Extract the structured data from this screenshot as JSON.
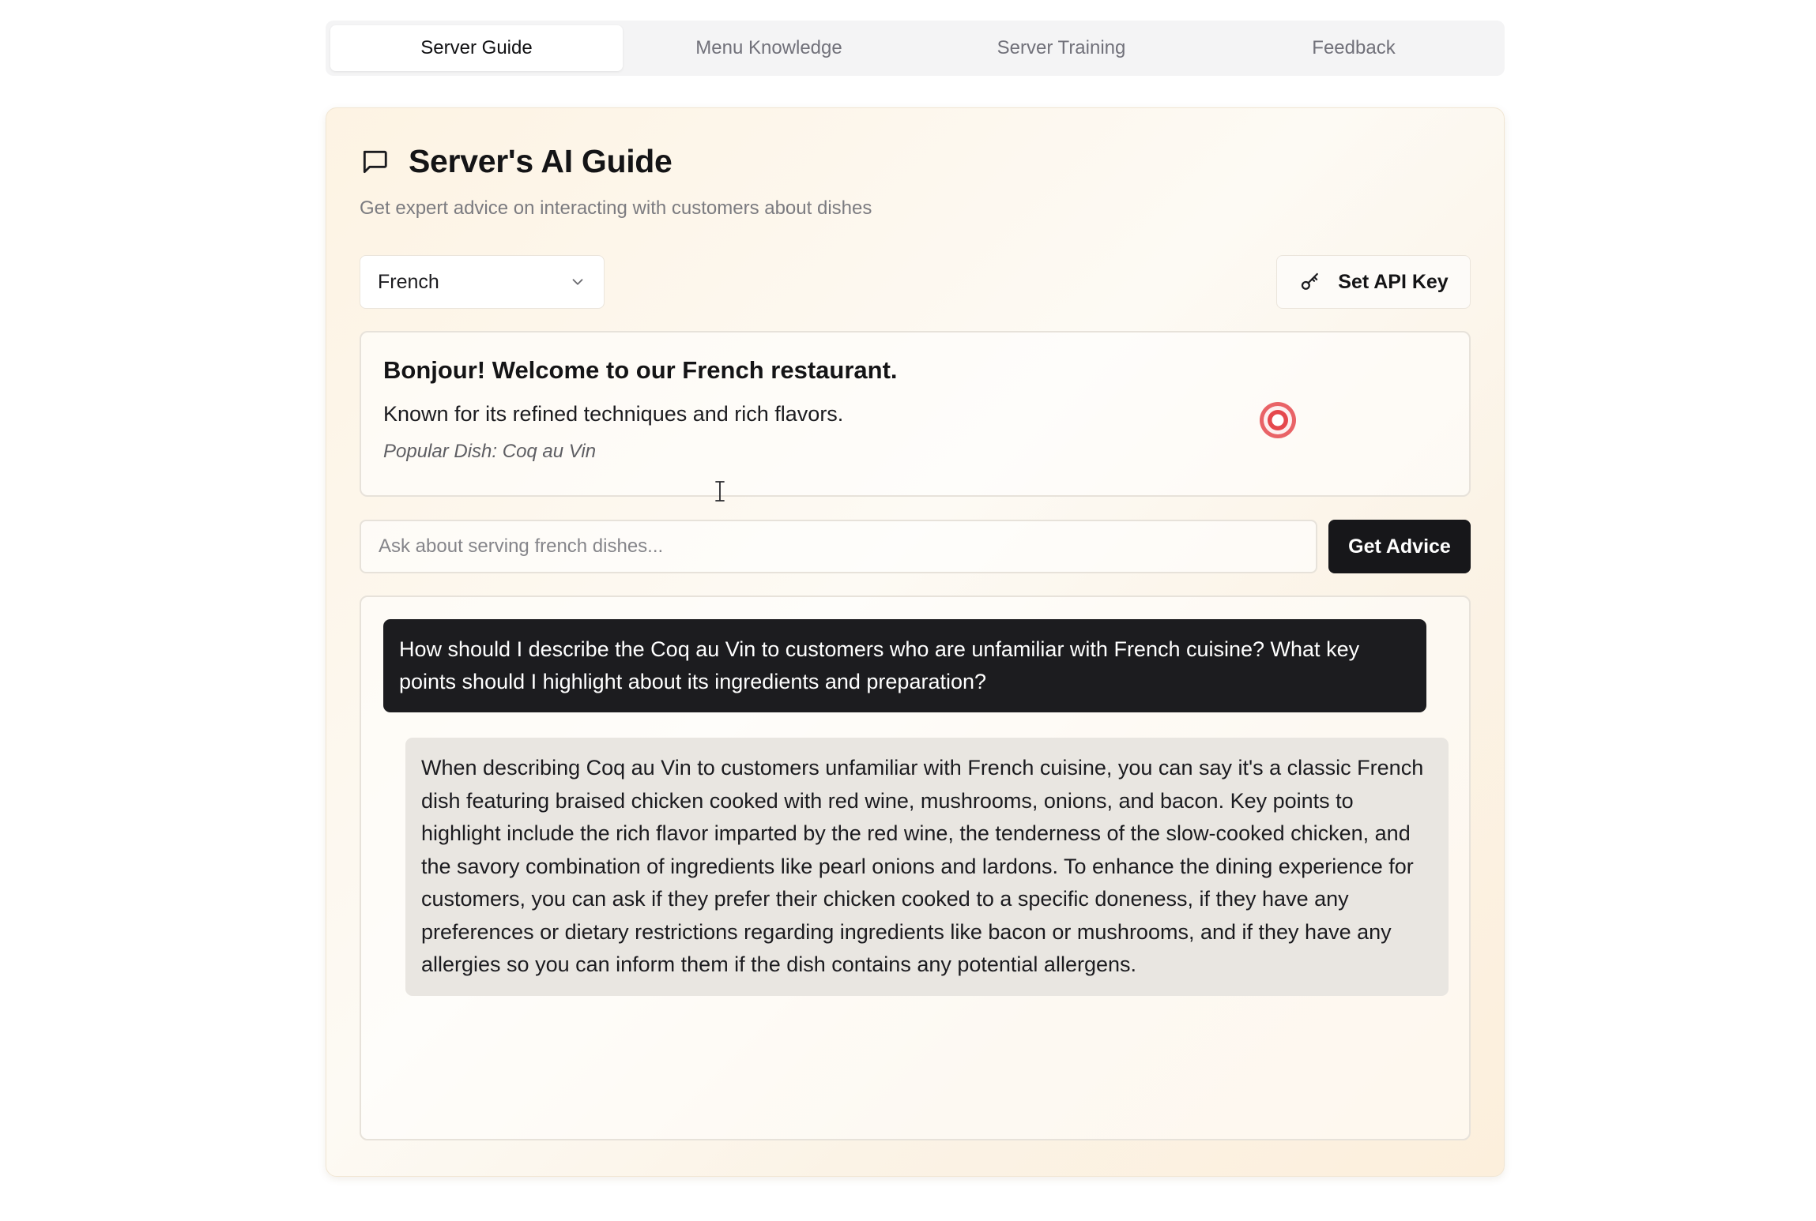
{
  "tabs": [
    {
      "label": "Server Guide",
      "active": true
    },
    {
      "label": "Menu Knowledge",
      "active": false
    },
    {
      "label": "Server Training",
      "active": false
    },
    {
      "label": "Feedback",
      "active": false
    }
  ],
  "guide": {
    "title": "Server's AI Guide",
    "title_icon": "message-square-icon",
    "subtitle": "Get expert advice on interacting with customers about dishes"
  },
  "cuisine_select": {
    "selected": "French",
    "icon": "chevron-down-icon"
  },
  "api_key_button": {
    "label": "Set API Key",
    "icon": "key-icon"
  },
  "welcome": {
    "greeting": "Bonjour! Welcome to our French restaurant.",
    "description": "Known for its refined techniques and rich flavors.",
    "popular_dish": "Popular Dish: Coq au Vin",
    "indicator_color": "#e5484d"
  },
  "ask": {
    "placeholder": "Ask about serving french dishes...",
    "value": "",
    "button_label": "Get Advice"
  },
  "conversation": [
    {
      "role": "user",
      "text": "How should I describe the Coq au Vin to customers who are unfamiliar with French cuisine? What key points should I highlight about its ingredients and preparation?"
    },
    {
      "role": "assistant",
      "text": "When describing Coq au Vin to customers unfamiliar with French cuisine, you can say it's a classic French dish featuring braised chicken cooked with red wine, mushrooms, onions, and bacon. Key points to highlight include the rich flavor imparted by the red wine, the tenderness of the slow-cooked chicken, and the savory combination of ingredients like pearl onions and lardons. To enhance the dining experience for customers, you can ask if they prefer their chicken cooked to a specific doneness, if they have any preferences or dietary restrictions regarding ingredients like bacon or mushrooms, and if they have any allergies so you can inform them if the dish contains any potential allergens."
    }
  ],
  "colors": {
    "accent_dark": "#17171a",
    "card_tint": "#fdf3e3",
    "assistant_bubble": "#e9e6e1"
  }
}
